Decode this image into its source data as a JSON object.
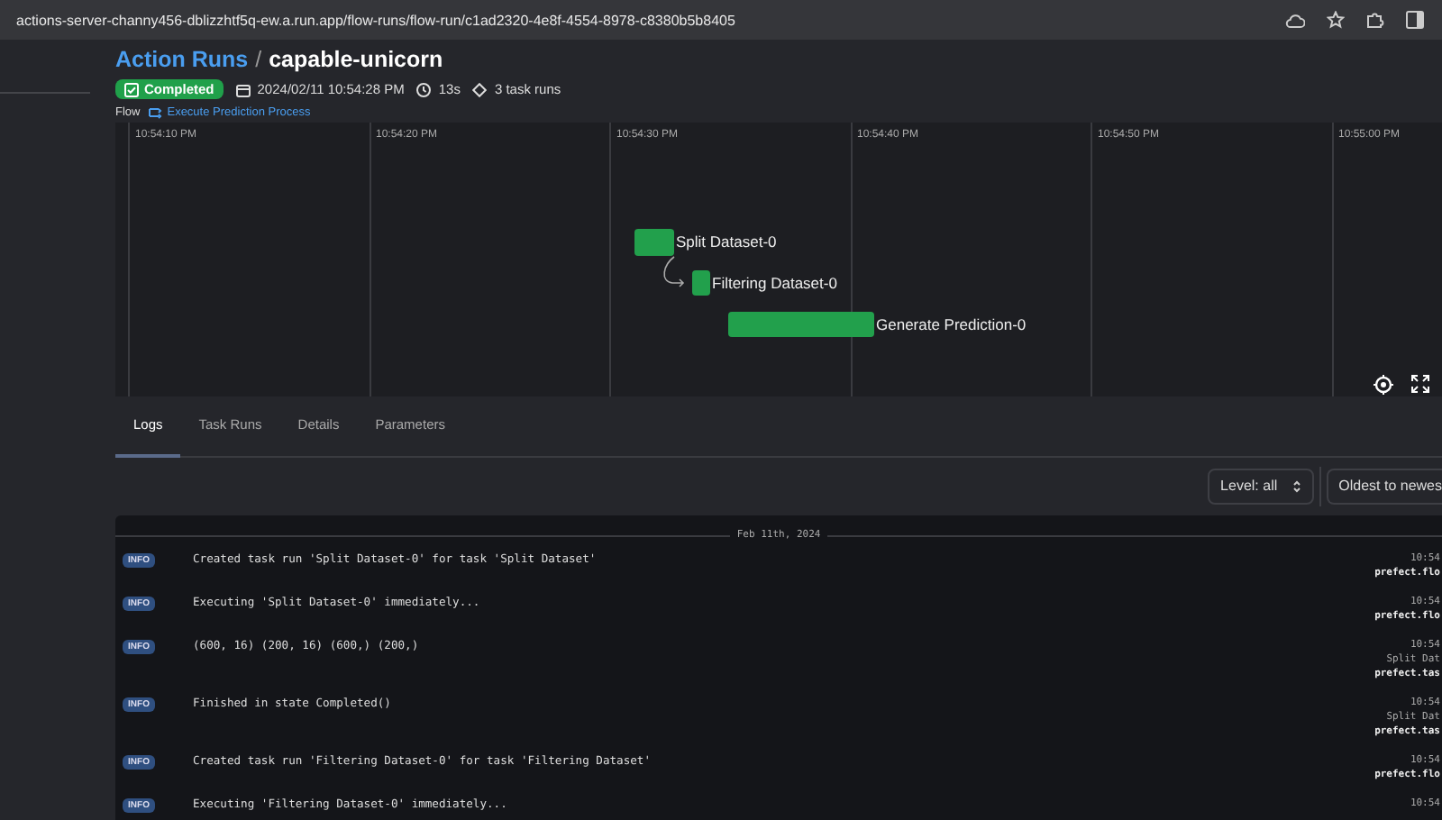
{
  "browser": {
    "url": "actions-server-channy456-dblizzhtf5q-ew.a.run.app/flow-runs/flow-run/c1ad2320-4e8f-4554-8978-c8380b5b8405"
  },
  "header": {
    "breadcrumb": "Action Runs",
    "separator": "/",
    "title": "capable-unicorn",
    "status": "Completed",
    "date": "2024/02/11 10:54:28 PM",
    "duration": "13s",
    "task_runs": "3 task runs",
    "flow_label": "Flow",
    "flow_name": "Execute Prediction Process"
  },
  "timeline": {
    "ticks": [
      "10:54:10 PM",
      "10:54:20 PM",
      "10:54:30 PM",
      "10:54:40 PM",
      "10:54:50 PM",
      "10:55:00 PM"
    ],
    "tasks": [
      {
        "name": "Split Dataset-0"
      },
      {
        "name": "Filtering Dataset-0"
      },
      {
        "name": "Generate Prediction-0"
      }
    ]
  },
  "tabs": [
    {
      "label": "Logs",
      "selected": true
    },
    {
      "label": "Task Runs",
      "selected": false
    },
    {
      "label": "Details",
      "selected": false
    },
    {
      "label": "Parameters",
      "selected": false
    }
  ],
  "filters": {
    "level": "Level: all",
    "order": "Oldest to newes"
  },
  "logs": {
    "date": "Feb 11th, 2024",
    "rows": [
      {
        "level": "INFO",
        "message": "Created task run 'Split Dataset-0' for task 'Split Dataset'",
        "meta": [
          "10:54",
          "prefect.flo"
        ]
      },
      {
        "level": "INFO",
        "message": "Executing 'Split Dataset-0' immediately...",
        "meta": [
          "10:54",
          "prefect.flo"
        ]
      },
      {
        "level": "INFO",
        "message": "(600, 16) (200, 16) (600,) (200,)",
        "meta": [
          "10:54",
          "Split Dat",
          "prefect.tas"
        ]
      },
      {
        "level": "INFO",
        "message": "Finished in state Completed()",
        "meta": [
          "10:54",
          "Split Dat",
          "prefect.tas"
        ]
      },
      {
        "level": "INFO",
        "message": "Created task run 'Filtering Dataset-0' for task 'Filtering Dataset'",
        "meta": [
          "10:54",
          "prefect.flo"
        ]
      },
      {
        "level": "INFO",
        "message": "Executing 'Filtering Dataset-0' immediately...",
        "meta": [
          "10:54"
        ]
      }
    ]
  }
}
